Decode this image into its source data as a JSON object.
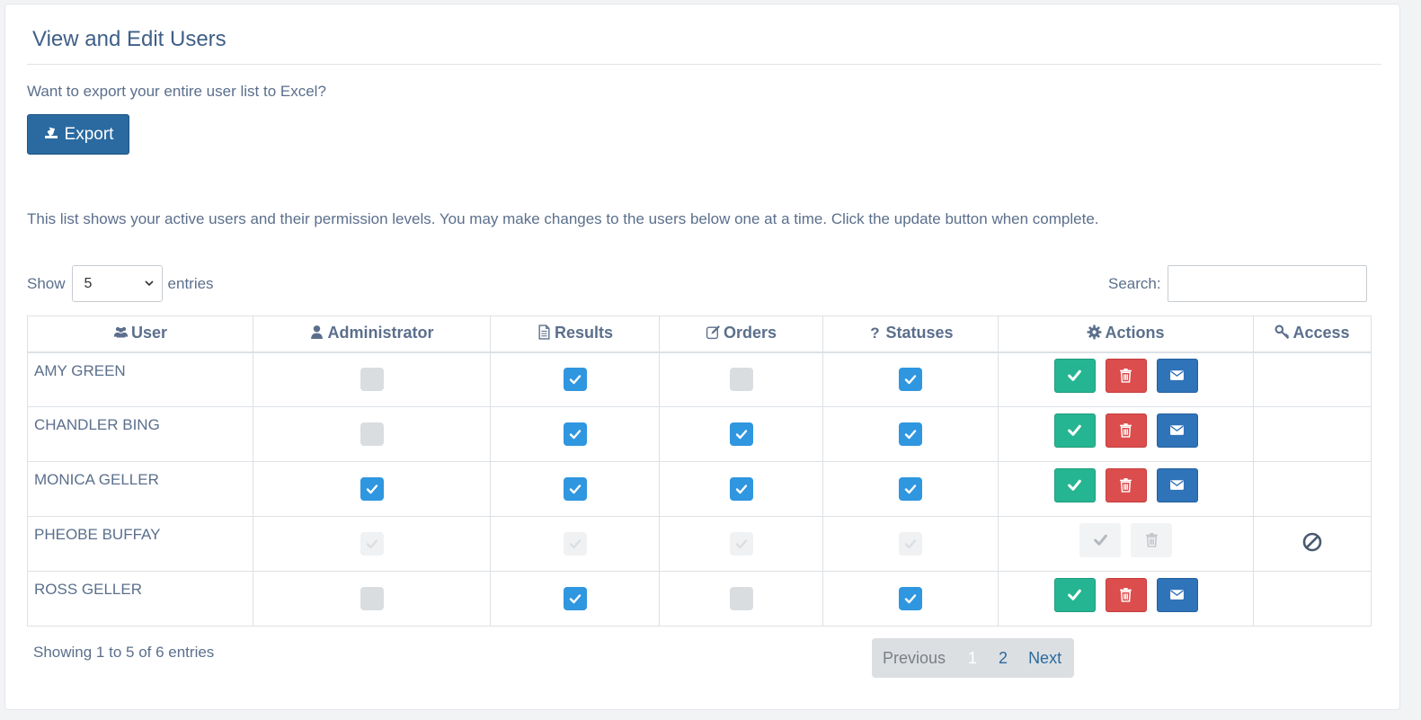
{
  "page": {
    "title": "View and Edit Users",
    "export_prompt": "Want to export your entire user list to Excel?",
    "export_label": "Export",
    "info": "This list shows your active users and their permission levels. You may make changes to the users below one at a time. Click the update button when complete."
  },
  "length_control": {
    "show_label": "Show",
    "selected": "5",
    "entries_label": "entries"
  },
  "search": {
    "label": "Search:",
    "value": ""
  },
  "table": {
    "headers": [
      {
        "label": "User",
        "icon": "users-icon"
      },
      {
        "label": "Administrator",
        "icon": "user-icon"
      },
      {
        "label": "Results",
        "icon": "document-icon"
      },
      {
        "label": "Orders",
        "icon": "edit-icon"
      },
      {
        "label": "Statuses",
        "icon": "question-icon"
      },
      {
        "label": "Actions",
        "icon": "gear-icon"
      },
      {
        "label": "Access",
        "icon": "key-icon"
      }
    ],
    "rows": [
      {
        "name": "AMY GREEN",
        "administrator": "unchecked",
        "results": "checked",
        "orders": "unchecked",
        "statuses": "checked",
        "enabled": true,
        "access": ""
      },
      {
        "name": "CHANDLER BING",
        "administrator": "unchecked",
        "results": "checked",
        "orders": "checked",
        "statuses": "checked",
        "enabled": true,
        "access": ""
      },
      {
        "name": "MONICA GELLER",
        "administrator": "checked",
        "results": "checked",
        "orders": "checked",
        "statuses": "checked",
        "enabled": true,
        "access": ""
      },
      {
        "name": "PHEOBE BUFFAY",
        "administrator": "disabled",
        "results": "disabled",
        "orders": "disabled",
        "statuses": "disabled",
        "enabled": false,
        "access": "ban-icon"
      },
      {
        "name": "ROSS GELLER",
        "administrator": "unchecked",
        "results": "checked",
        "orders": "unchecked",
        "statuses": "checked",
        "enabled": true,
        "access": ""
      }
    ]
  },
  "footer": {
    "info": "Showing 1 to 5 of 6 entries",
    "pagination": {
      "previous": "Previous",
      "pages": [
        "1",
        "2"
      ],
      "current": "1",
      "next": "Next"
    }
  },
  "colors": {
    "primary": "#2a6aa0",
    "checkbox_on": "#2f96e0",
    "success": "#26b592",
    "danger": "#dc4d4d",
    "info": "#2f73b9"
  }
}
